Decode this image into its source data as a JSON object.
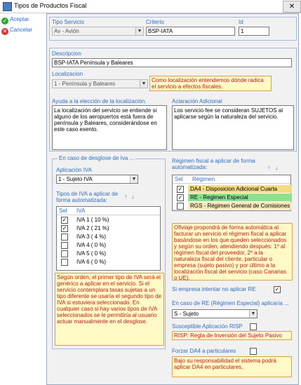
{
  "window": {
    "title": "Tipos de Productos Fiscal",
    "close": "✕"
  },
  "toolbar": {
    "accept_label": "Aceptar",
    "cancel_label": "Cancelar"
  },
  "top": {
    "tipo_servicio_label": "Tipo Servicio",
    "tipo_servicio_value": "Av - Avión",
    "criterio_label": "Criterio",
    "criterio_value": "BSP-IATA",
    "id_label": "Id",
    "id_value": "1"
  },
  "descripcion": {
    "label": "Descripcion",
    "value": "BSP-IATA Península y Baleares"
  },
  "localizacion": {
    "label": "Localizacion",
    "value": "1 - Península y Baleares",
    "note": "Como localización entendemos dónde radica el servicio a efectos fiscales."
  },
  "ayuda": {
    "label": "Ayuda a la elección de la localización.",
    "text": "La localización del servicio se entiende si alguno de los aeropuertos está fuera de península y Baleares, considerándose en este caso exento."
  },
  "aclaracion": {
    "label": "Aclaración Adicional",
    "text": "Los servicio fee se consideran SUJETOS al aplicarse según la naturaleza del servicio."
  },
  "desglose": {
    "title": "En caso de desglose de Iva ...",
    "aplicacion_label": "Aplicación IVA",
    "aplicacion_value": "1 - Sujeto IVA",
    "tipos_label": "Tipos de IVA a aplicar de forma automatizada:",
    "col_sel": "Sel",
    "col_iva": "IVA",
    "rows": [
      {
        "label": "IVA 1 ( 10 %)",
        "checked": true
      },
      {
        "label": "IVA 2 ( 21 %)",
        "checked": true
      },
      {
        "label": "IVA 3 ( 4 %)",
        "checked": false
      },
      {
        "label": "IVA 4 ( 0 %)",
        "checked": false
      },
      {
        "label": "IVA 5 ( 0 %)",
        "checked": false
      },
      {
        "label": "IVA 6 ( 0 %)",
        "checked": false
      }
    ],
    "note": "Según orden, el primer tipo de IVA será el genérico a aplicar en el servicio. Si el servicio contemplara tasas sujetas a un tipo diferente se usaría el segundo tipo de IVA si estuviera seleccionado. En cualquier caso si hay varios tipos de IVA seleccionados se le permitiría al usuario actuar manualmente en el desglose."
  },
  "regimen": {
    "label": "Régimen fiscal a aplicar de forma automatizada:",
    "col_sel": "Sel",
    "col_reg": "Régimen",
    "rows": [
      {
        "label": "DA4 - Disposicion Adicional Cuarta",
        "checked": true,
        "color": "#f4dc82"
      },
      {
        "label": "RE - Regimen Especial",
        "checked": true,
        "color": "#8fe08f"
      },
      {
        "label": "RGS - Régimen General de Comisiones",
        "checked": false,
        "color": "#f8e6b8"
      }
    ],
    "note": "Ofiviaje propondrá de forma automática al facturar un servicio el régimen fiscal a aplicar basándose en los que queden seleccionados y según su orden, atendiendo después: 1º al régimen fiscal del proveedor, 2º a la naturaleza fiscal del cliente, particular o empresa (sujeto pasivo) y por último a la localización fiscal del servicio (caso Canarias o UE)."
  },
  "si_empresa": {
    "label": "Si empresa intentar no aplicar RE",
    "checked": true
  },
  "caso_re": {
    "label": "En caso de RE (Régimen Especial) aplicaría ...",
    "value": "S - Sujeto"
  },
  "risp": {
    "label": "Susceptible Aplicación RISP",
    "checked": false,
    "note": "RISP: Regla de Inversión del Sujeto Pasivo"
  },
  "da4": {
    "label": "Forzar DA4 a particulares",
    "checked": false,
    "note": "Bajo su responsabilidad el sistema podrá aplicar DA4 en particulares,"
  },
  "colors": {
    "label_blue": "#2f6fbf",
    "note_bg": "#fff9c6",
    "note_text": "#b31d1d"
  }
}
